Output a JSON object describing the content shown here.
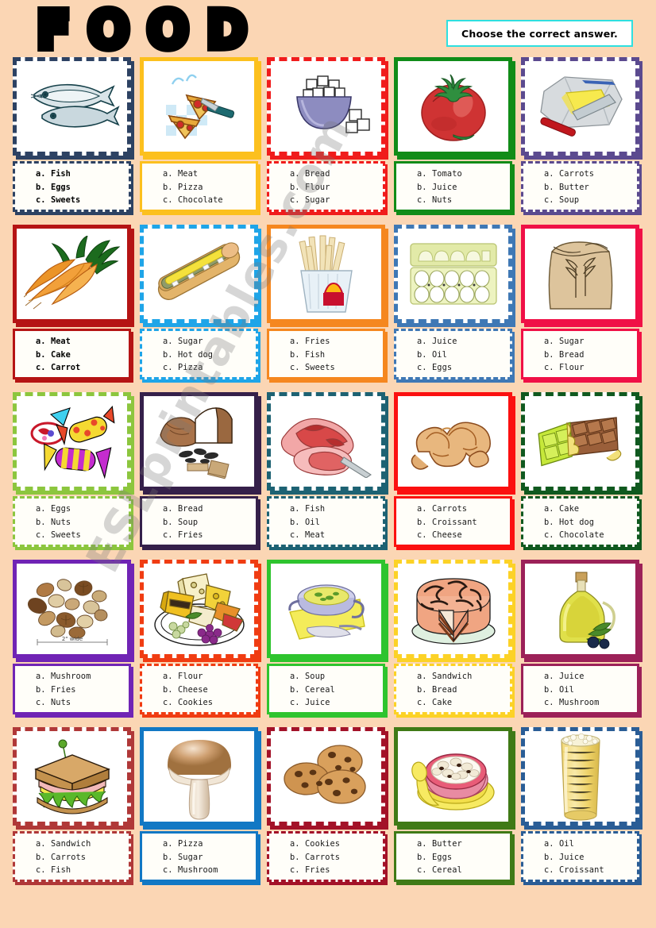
{
  "header": {
    "title": "FOOD",
    "instruction": "Choose the correct answer."
  },
  "watermark": "ESLprintables.com",
  "colors": {
    "page_background": "#fbd6b4",
    "instruction_border": "#2ee0e0",
    "card_background": "#ffffff"
  },
  "cards": [
    {
      "picture": "fish-icon",
      "frame_color": "#2d4263",
      "frame_style": "dashed",
      "answer_style": "bold",
      "options": [
        "Fish",
        "Eggs",
        "Sweets"
      ],
      "letters": [
        "a.",
        "b.",
        "c."
      ]
    },
    {
      "picture": "pizza-icon",
      "frame_color": "#fcc01e",
      "frame_style": "solid",
      "answer_style": "normal",
      "options": [
        "Meat",
        "Pizza",
        "Chocolate"
      ],
      "letters": [
        "a.",
        "b.",
        "c."
      ]
    },
    {
      "picture": "sugar-bowl-icon",
      "frame_color": "#f01c1c",
      "frame_style": "dashed",
      "answer_style": "normal",
      "options": [
        "Bread",
        "Flour",
        "Sugar"
      ],
      "letters": [
        "a.",
        "b.",
        "c."
      ]
    },
    {
      "picture": "tomato-icon",
      "frame_color": "#118c18",
      "frame_style": "solid",
      "answer_style": "normal",
      "options": [
        "Tomato",
        "Juice",
        "Nuts"
      ],
      "letters": [
        "a.",
        "b.",
        "c."
      ]
    },
    {
      "picture": "butter-icon",
      "frame_color": "#5b4a8f",
      "frame_style": "dashed",
      "answer_style": "normal",
      "options": [
        "Carrots",
        "Butter",
        "Soup"
      ],
      "letters": [
        "a.",
        "b.",
        "c."
      ]
    },
    {
      "picture": "carrots-icon",
      "frame_color": "#b51414",
      "frame_style": "solid",
      "answer_style": "bold",
      "options": [
        "Meat",
        "Cake",
        "Carrot"
      ],
      "letters": [
        "a.",
        "b.",
        "c."
      ]
    },
    {
      "picture": "hotdog-icon",
      "frame_color": "#1fa5e8",
      "frame_style": "dashed",
      "answer_style": "normal",
      "options": [
        "Sugar",
        "Hot dog",
        "Pizza"
      ],
      "letters": [
        "a.",
        "b.",
        "c."
      ]
    },
    {
      "picture": "fries-icon",
      "frame_color": "#f5871f",
      "frame_style": "solid",
      "answer_style": "normal",
      "options": [
        "Fries",
        "Fish",
        "Sweets"
      ],
      "letters": [
        "a.",
        "b.",
        "c."
      ]
    },
    {
      "picture": "egg-carton-icon",
      "frame_color": "#3f78b5",
      "frame_style": "dashed",
      "answer_style": "normal",
      "options": [
        "Juice",
        "Oil",
        "Eggs"
      ],
      "letters": [
        "a.",
        "b.",
        "c."
      ]
    },
    {
      "picture": "flour-sack-icon",
      "frame_color": "#f01046",
      "frame_style": "solid",
      "answer_style": "normal",
      "options": [
        "Sugar",
        "Bread",
        "Flour"
      ],
      "letters": [
        "a.",
        "b.",
        "c."
      ]
    },
    {
      "picture": "sweets-icon",
      "frame_color": "#8cc63e",
      "frame_style": "dashed",
      "answer_style": "normal",
      "options": [
        "Eggs",
        "Nuts",
        "Sweets"
      ],
      "letters": [
        "a.",
        "b.",
        "c."
      ]
    },
    {
      "picture": "bread-icon",
      "frame_color": "#35204a",
      "frame_style": "solid",
      "answer_style": "normal",
      "options": [
        "Bread",
        "Soup",
        "Fries"
      ],
      "letters": [
        "a.",
        "b.",
        "c."
      ]
    },
    {
      "picture": "meat-icon",
      "frame_color": "#1d6273",
      "frame_style": "dashed",
      "answer_style": "normal",
      "options": [
        "Fish",
        "Oil",
        "Meat"
      ],
      "letters": [
        "a.",
        "b.",
        "c."
      ]
    },
    {
      "picture": "croissant-icon",
      "frame_color": "#fb1010",
      "frame_style": "solid",
      "answer_style": "normal",
      "options": [
        "Carrots",
        "Croissant",
        "Cheese"
      ],
      "letters": [
        "a.",
        "b.",
        "c."
      ]
    },
    {
      "picture": "chocolate-icon",
      "frame_color": "#10591f",
      "frame_style": "dashed",
      "answer_style": "normal",
      "options": [
        "Cake",
        "Hot dog",
        "Chocolate"
      ],
      "letters": [
        "a.",
        "b.",
        "c."
      ]
    },
    {
      "picture": "nuts-icon",
      "frame_color": "#7024b5",
      "frame_style": "solid",
      "answer_style": "normal",
      "options": [
        "Mushroom",
        "Fries",
        "Nuts"
      ],
      "letters": [
        "a.",
        "b.",
        "c."
      ]
    },
    {
      "picture": "cheese-platter-icon",
      "frame_color": "#f03c12",
      "frame_style": "dashed",
      "answer_style": "normal",
      "options": [
        "Flour",
        "Cheese",
        "Cookies"
      ],
      "letters": [
        "a.",
        "b.",
        "c."
      ]
    },
    {
      "picture": "soup-icon",
      "frame_color": "#2ec42e",
      "frame_style": "solid",
      "answer_style": "normal",
      "options": [
        "Soup",
        "Cereal",
        "Juice"
      ],
      "letters": [
        "a.",
        "b.",
        "c."
      ]
    },
    {
      "picture": "cake-icon",
      "frame_color": "#fcd226",
      "frame_style": "dashed",
      "answer_style": "normal",
      "options": [
        "Sandwich",
        "Bread",
        "Cake"
      ],
      "letters": [
        "a.",
        "b.",
        "c."
      ]
    },
    {
      "picture": "olive-oil-icon",
      "frame_color": "#9c2158",
      "frame_style": "solid",
      "answer_style": "normal",
      "options": [
        "Juice",
        "Oil",
        "Mushroom"
      ],
      "letters": [
        "a.",
        "b.",
        "c."
      ]
    },
    {
      "picture": "sandwich-icon",
      "frame_color": "#b03838",
      "frame_style": "dashed",
      "answer_style": "normal",
      "options": [
        "Sandwich",
        "Carrots",
        "Fish"
      ],
      "letters": [
        "a.",
        "b.",
        "c."
      ]
    },
    {
      "picture": "mushroom-icon",
      "frame_color": "#1278c4",
      "frame_style": "solid",
      "answer_style": "normal",
      "options": [
        "Pizza",
        "Sugar",
        "Mushroom"
      ],
      "letters": [
        "a.",
        "b.",
        "c."
      ]
    },
    {
      "picture": "cookies-icon",
      "frame_color": "#a31228",
      "frame_style": "dashed",
      "answer_style": "normal",
      "options": [
        "Cookies",
        "Carrots",
        "Fries"
      ],
      "letters": [
        "a.",
        "b.",
        "c."
      ]
    },
    {
      "picture": "cereal-bowl-icon",
      "frame_color": "#3f7a16",
      "frame_style": "solid",
      "answer_style": "normal",
      "options": [
        "Butter",
        "Eggs",
        "Cereal"
      ],
      "letters": [
        "a.",
        "b.",
        "c."
      ]
    },
    {
      "picture": "juice-glass-icon",
      "frame_color": "#2a5d96",
      "frame_style": "dashed",
      "answer_style": "normal",
      "options": [
        "Oil",
        "Juice",
        "Croissant"
      ],
      "letters": [
        "a.",
        "b.",
        "c."
      ]
    }
  ]
}
